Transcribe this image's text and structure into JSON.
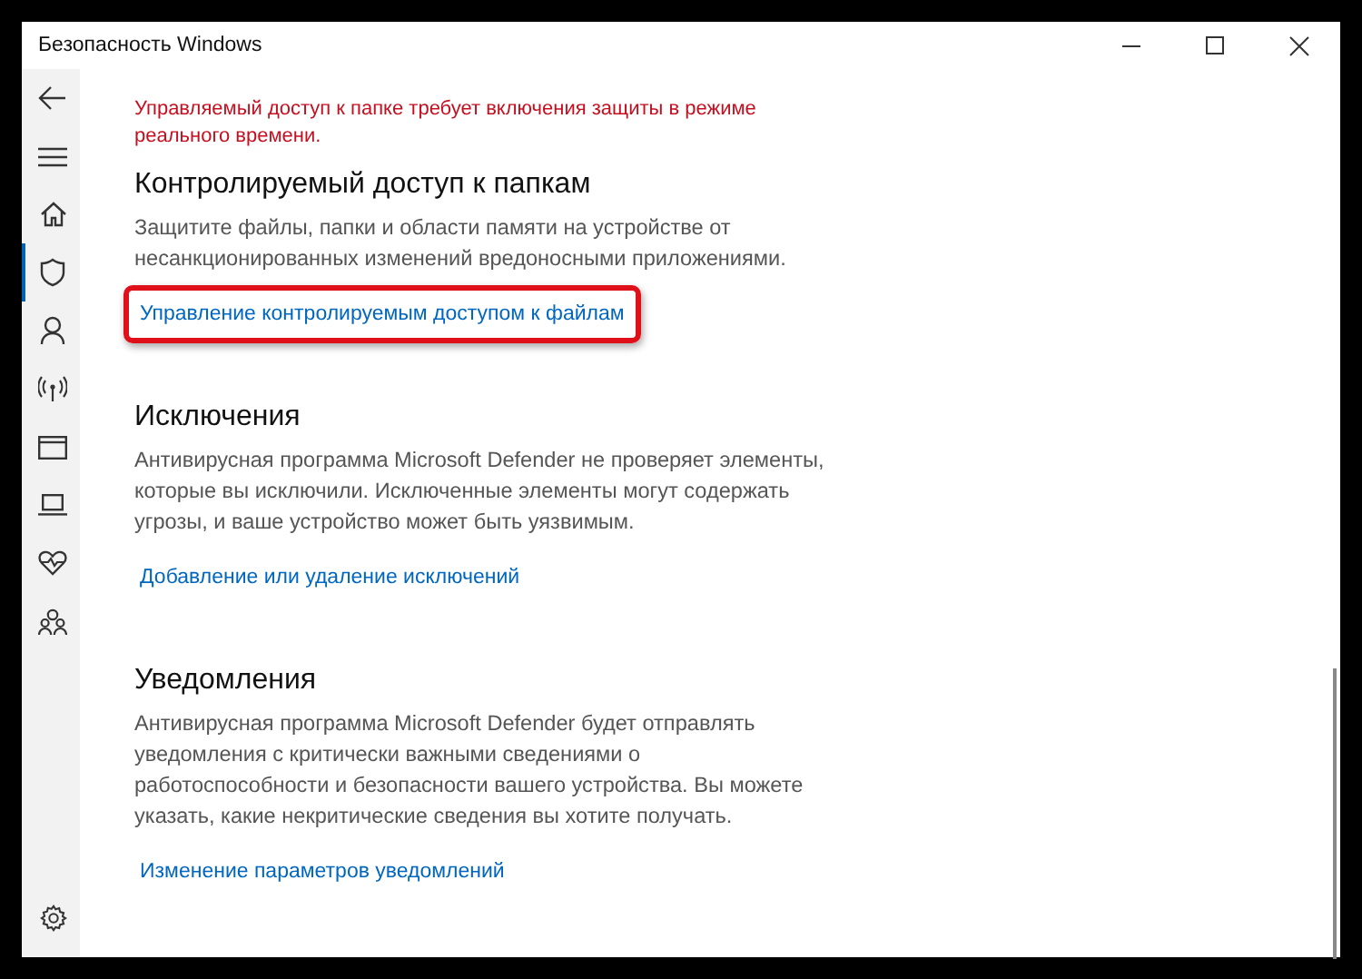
{
  "window": {
    "title": "Безопасность Windows"
  },
  "nav": [
    {
      "kind": "back",
      "selected": false
    },
    {
      "kind": "menu",
      "selected": false
    },
    {
      "kind": "home",
      "selected": false
    },
    {
      "kind": "shield",
      "selected": true
    },
    {
      "kind": "person",
      "selected": false
    },
    {
      "kind": "wireless",
      "selected": false
    },
    {
      "kind": "browser",
      "selected": false
    },
    {
      "kind": "laptop",
      "selected": false
    },
    {
      "kind": "heart",
      "selected": false
    },
    {
      "kind": "family",
      "selected": false
    }
  ],
  "nav_bottom": [
    {
      "kind": "settings",
      "selected": false
    }
  ],
  "alert": "Управляемый доступ к папке требует включения защиты в режиме реального времени.",
  "sections": [
    {
      "heading": "Контролируемый доступ к папкам",
      "description": "Защитите файлы, папки и области памяти на устройстве от несанкционированных изменений вредоносными приложениями.",
      "link": {
        "label": "Управление контролируемым доступом к файлам",
        "highlighted": true
      }
    },
    {
      "heading": "Исключения",
      "description": "Антивирусная программа Microsoft Defender не проверяет элементы, которые вы исключили. Исключенные элементы могут содержать угрозы, и ваше устройство может быть уязвимым.",
      "link": {
        "label": "Добавление или удаление исключений",
        "highlighted": false
      }
    },
    {
      "heading": "Уведомления",
      "description": "Антивирусная программа Microsoft Defender будет отправлять уведомления с критически важными сведениями о работоспособности и безопасности вашего устройства. Вы можете указать, какие некритические сведения вы хотите получать.",
      "link": {
        "label": "Изменение параметров уведомлений",
        "highlighted": false
      }
    }
  ]
}
